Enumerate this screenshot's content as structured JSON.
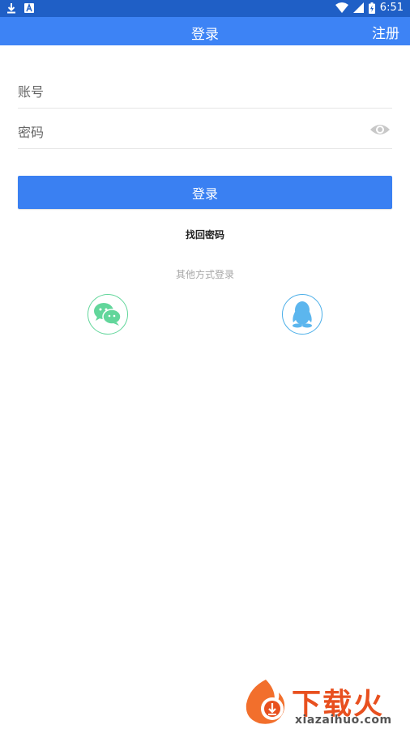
{
  "status_bar": {
    "time": "6:51"
  },
  "app_bar": {
    "title": "登录",
    "register_label": "注册"
  },
  "form": {
    "account_placeholder": "账号",
    "password_placeholder": "密码",
    "login_label": "登录",
    "forgot_label": "找回密码"
  },
  "other_login": {
    "label": "其他方式登录",
    "methods": [
      "wechat-icon",
      "qq-icon"
    ]
  },
  "watermark": {
    "text": "下载火",
    "url": "xiazaihuo.com"
  },
  "colors": {
    "status_bar": "#1f5fc6",
    "app_bar": "#3d83f5",
    "button": "#3a80f2",
    "wechat": "#62d69b",
    "qq": "#4aaee8",
    "watermark": "#e8501f"
  }
}
